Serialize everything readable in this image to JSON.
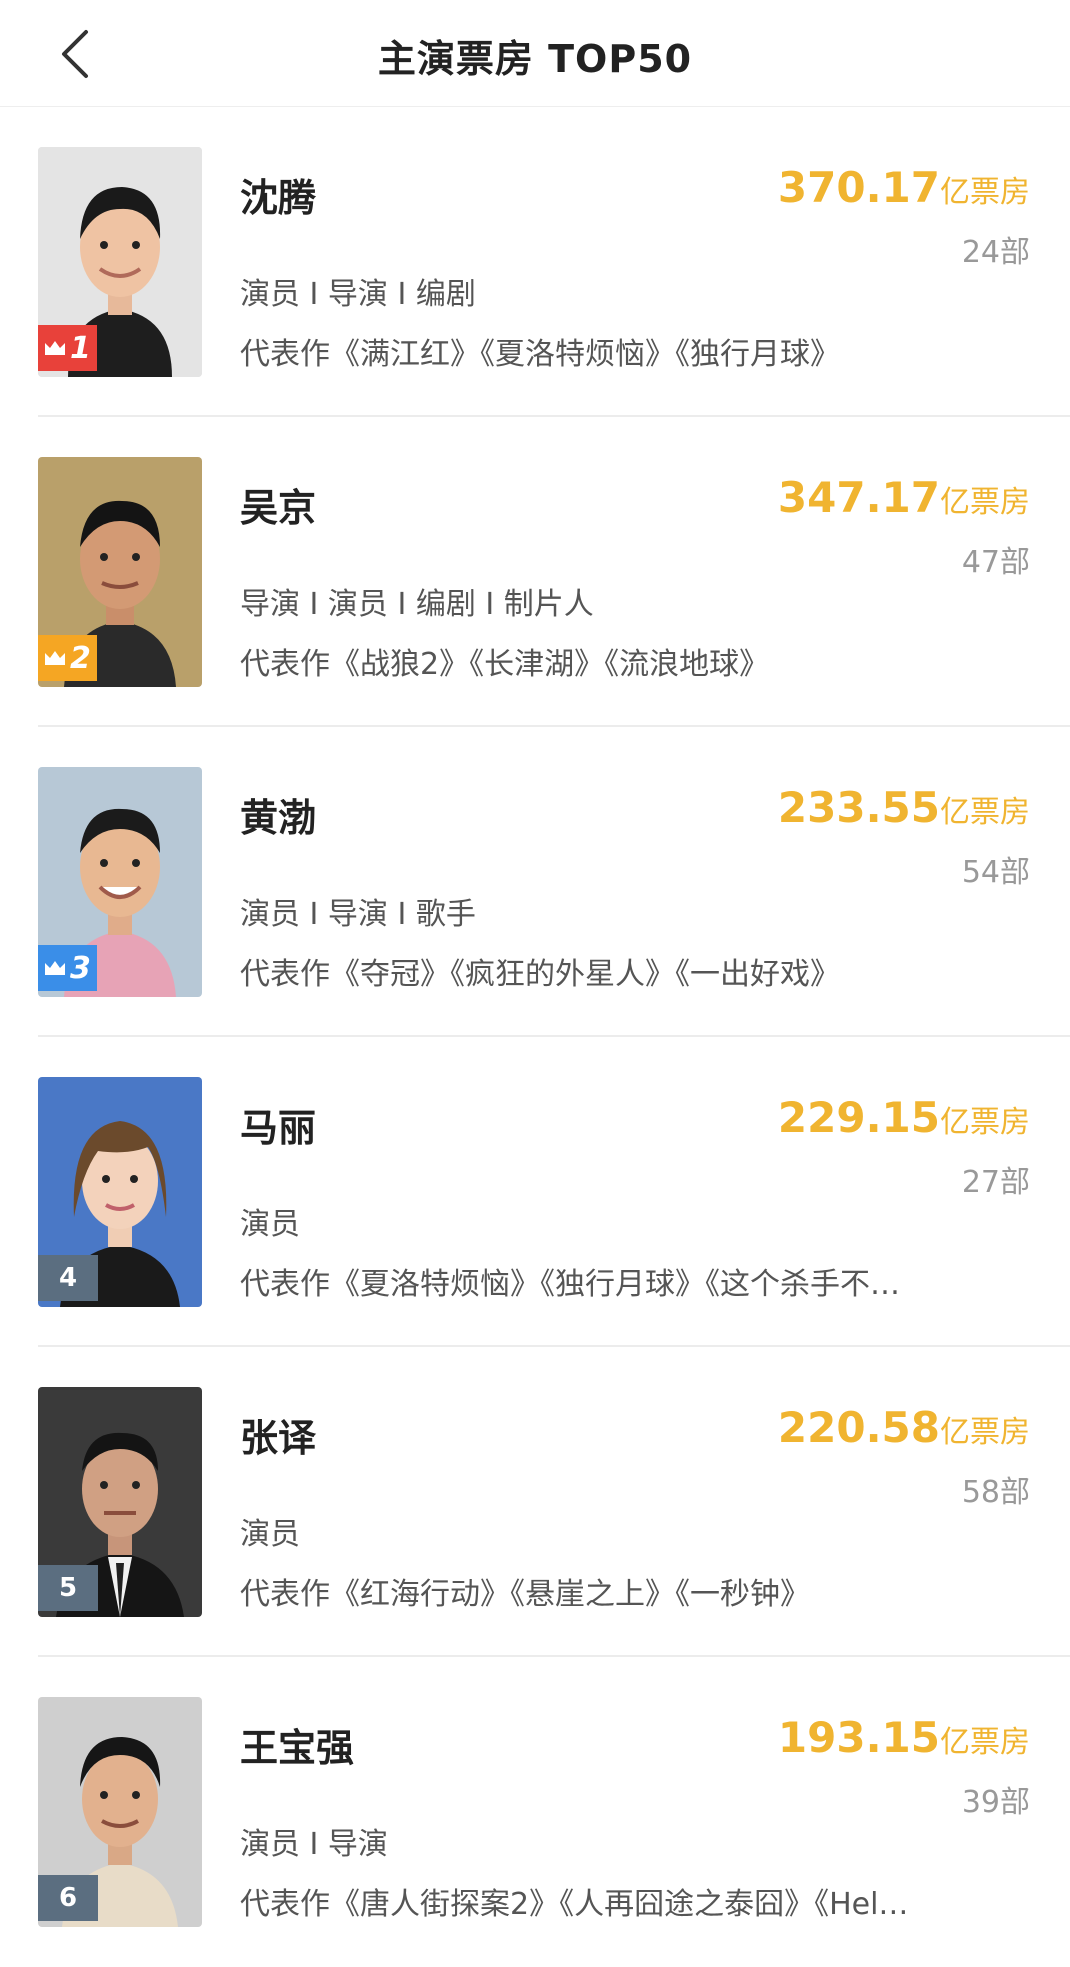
{
  "header": {
    "title": "主演票房 TOP50",
    "back_icon": "chevron-left-icon"
  },
  "colors": {
    "accent": "#f0b430",
    "rank1": "#e8413a",
    "rank2": "#f5a623",
    "rank3": "#3a8ee8",
    "rank_other": "#5b6e80"
  },
  "list": [
    {
      "rank": "1",
      "crown": true,
      "name": "沈腾",
      "box_office": "370.17",
      "unit": "亿票房",
      "count": "24部",
      "roles": "演员 I 导演 I 编剧",
      "works": "代表作《满江红》《夏洛特烦恼》《独行月球》"
    },
    {
      "rank": "2",
      "crown": true,
      "name": "吴京",
      "box_office": "347.17",
      "unit": "亿票房",
      "count": "47部",
      "roles": "导演 I 演员 I 编剧 I 制片人",
      "works": "代表作《战狼2》《长津湖》《流浪地球》"
    },
    {
      "rank": "3",
      "crown": true,
      "name": "黄渤",
      "box_office": "233.55",
      "unit": "亿票房",
      "count": "54部",
      "roles": "演员 I 导演 I 歌手",
      "works": "代表作《夺冠》《疯狂的外星人》《一出好戏》"
    },
    {
      "rank": "4",
      "crown": false,
      "name": "马丽",
      "box_office": "229.15",
      "unit": "亿票房",
      "count": "27部",
      "roles": "演员",
      "works": "代表作《夏洛特烦恼》《独行月球》《这个杀手不…"
    },
    {
      "rank": "5",
      "crown": false,
      "name": "张译",
      "box_office": "220.58",
      "unit": "亿票房",
      "count": "58部",
      "roles": "演员",
      "works": "代表作《红海行动》《悬崖之上》《一秒钟》"
    },
    {
      "rank": "6",
      "crown": false,
      "name": "王宝强",
      "box_office": "193.15",
      "unit": "亿票房",
      "count": "39部",
      "roles": "演员 I 导演",
      "works": "代表作《唐人街探案2》《人再囧途之泰囧》《Hel…"
    }
  ]
}
